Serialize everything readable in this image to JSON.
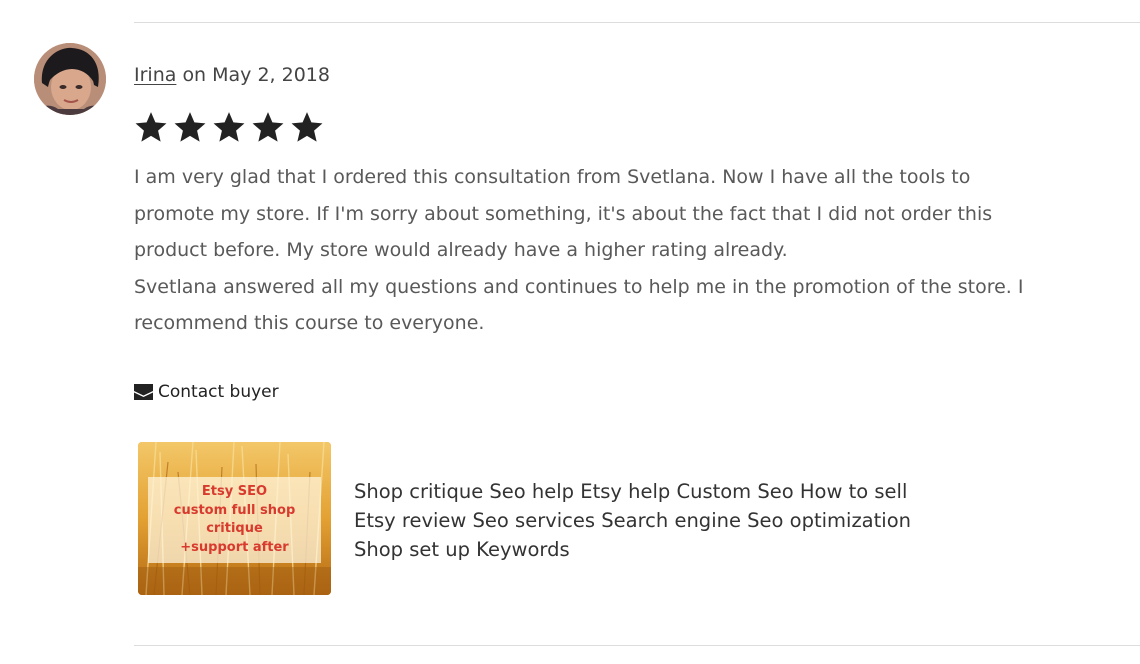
{
  "review": {
    "author": "Irina",
    "date_text": "on May 2, 2018",
    "rating": 5,
    "rating_max": 5,
    "text_lines": [
      "I am very glad that I ordered this consultation from Svetlana. Now I have all the tools to",
      "promote my store. If I'm sorry about something, it's about the fact that I did not order this",
      "product before. My store would already have a higher rating already.",
      "Svetlana answered all my questions and continues to help me in the promotion of the store. I",
      "recommend this course to everyone."
    ]
  },
  "contact": {
    "label": "Contact buyer",
    "icon": "envelope-icon"
  },
  "listing": {
    "thumbnail_lines": [
      "Etsy SEO",
      "custom full shop",
      "critique",
      "+support after"
    ],
    "title_lines": [
      "Shop critique Seo help Etsy help Custom Seo How to sell",
      "Etsy review Seo services Search engine Seo optimization",
      "Shop set up Keywords"
    ]
  },
  "colors": {
    "star": "#222222",
    "text_muted": "#595959",
    "thumbnail_text": "#d83a2e",
    "divider": "#dddddd"
  }
}
